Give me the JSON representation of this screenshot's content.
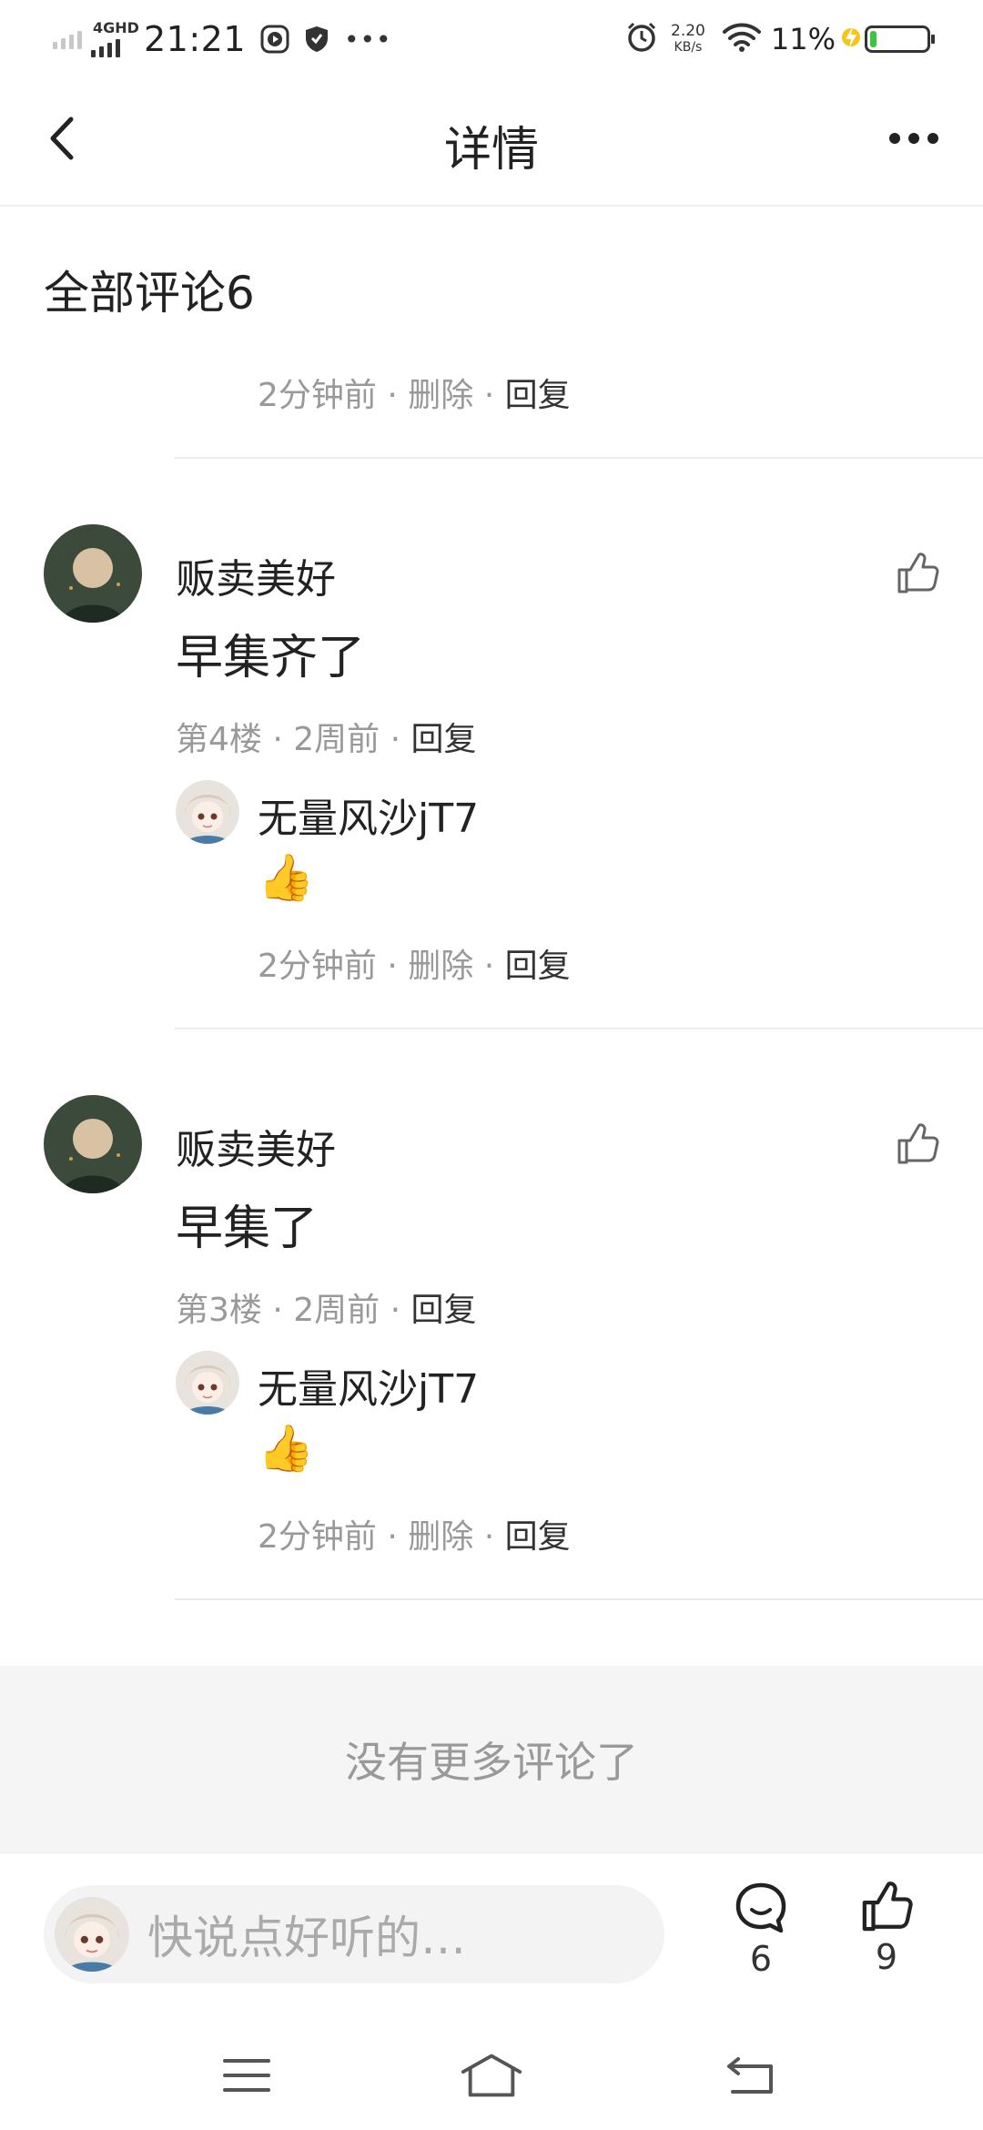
{
  "status_bar": {
    "network_type": "4GHD",
    "time": "21:21",
    "net_speed_value": "2.20",
    "net_speed_unit": "KB/s",
    "battery_percent": "11%",
    "battery_level": 0.11,
    "icons": [
      "signal-weak-icon",
      "signal-4g-icon",
      "play-icon",
      "shield-icon",
      "more-dots-icon",
      "alarm-icon",
      "wifi-icon",
      "charging-icon",
      "battery-icon"
    ]
  },
  "header": {
    "title": "详情",
    "back_icon": "chevron-left-icon",
    "more_icon": "more-horizontal-icon"
  },
  "comments_section": {
    "title": "全部评论6",
    "top_partial_reply": {
      "time": "2分钟前",
      "sep1": "·",
      "delete": "删除",
      "sep2": "·",
      "reply": "回复"
    },
    "comments": [
      {
        "user": "贩卖美好",
        "text": "早集齐了",
        "floor": "第4楼",
        "sep1": "·",
        "time": "2周前",
        "sep2": "·",
        "reply": "回复",
        "sub_reply": {
          "user": "无量风沙jT7",
          "emoji": "👍",
          "time": "2分钟前",
          "sep1": "·",
          "delete": "删除",
          "sep2": "·",
          "reply": "回复"
        }
      },
      {
        "user": "贩卖美好",
        "text": "早集了",
        "floor": "第3楼",
        "sep1": "·",
        "time": "2周前",
        "sep2": "·",
        "reply": "回复",
        "sub_reply": {
          "user": "无量风沙jT7",
          "emoji": "👍",
          "time": "2分钟前",
          "sep1": "·",
          "delete": "删除",
          "sep2": "·",
          "reply": "回复"
        }
      }
    ],
    "no_more": "没有更多评论了"
  },
  "bottom_bar": {
    "input_placeholder": "快说点好听的…",
    "comment_count": "6",
    "like_count": "9"
  },
  "colors": {
    "text_primary": "#222222",
    "text_secondary": "#999999",
    "divider": "#ececec",
    "no_more_bg": "#f5f5f5",
    "battery_fill": "#3cc43c",
    "charging": "#f5c518"
  }
}
